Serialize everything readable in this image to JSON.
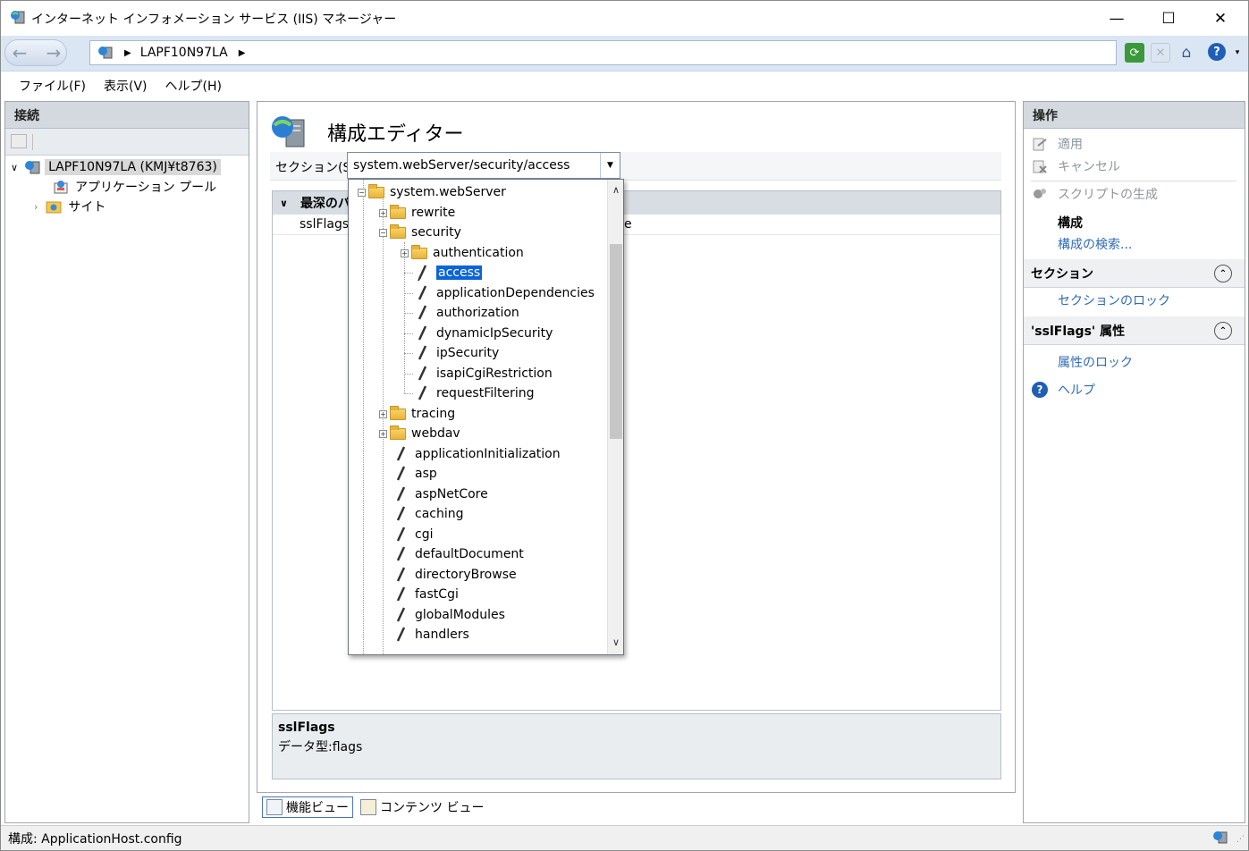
{
  "window": {
    "title": "インターネット インフォメーション サービス (IIS) マネージャー",
    "minimize": "—",
    "maximize": "☐",
    "close": "✕"
  },
  "address": {
    "back_icon": "back-arrow-icon",
    "forward_icon": "forward-arrow-icon",
    "path": "LAPF10N97LA",
    "sep": "▶"
  },
  "toolbar_icons": [
    "refresh-icon",
    "stop-icon",
    "home-icon",
    "help-icon"
  ],
  "menu": [
    "ファイル(F)",
    "表示(V)",
    "ヘルプ(H)"
  ],
  "connections": {
    "title": "接続",
    "tree": {
      "server": "LAPF10N97LA (KMJ¥t8763)",
      "app_pools": "アプリケーション プール",
      "sites": "サイト"
    }
  },
  "center": {
    "title": "構成エディター",
    "section_label": "セクション(S):",
    "section_value": "system.webServer/security/access",
    "grid_header": "最深のパ",
    "grid_row": "sslFlags",
    "grid_row_tail": "e",
    "desc_title": "sslFlags",
    "desc_type": "データ型:flags"
  },
  "dropdown": {
    "root": "system.webServer",
    "items": {
      "rewrite": "rewrite",
      "security": "security",
      "authentication": "authentication",
      "access": "access",
      "applicationDependencies": "applicationDependencies",
      "authorization": "authorization",
      "dynamicIpSecurity": "dynamicIpSecurity",
      "ipSecurity": "ipSecurity",
      "isapiCgiRestriction": "isapiCgiRestriction",
      "requestFiltering": "requestFiltering",
      "tracing": "tracing",
      "webdav": "webdav",
      "applicationInitialization": "applicationInitialization",
      "asp": "asp",
      "aspNetCore": "aspNetCore",
      "caching": "caching",
      "cgi": "cgi",
      "defaultDocument": "defaultDocument",
      "directoryBrowse": "directoryBrowse",
      "fastCgi": "fastCgi",
      "globalModules": "globalModules",
      "handlers": "handlers"
    }
  },
  "views": {
    "features": "機能ビュー",
    "content": "コンテンツ ビュー"
  },
  "actions": {
    "title": "操作",
    "apply": "適用",
    "cancel": "キャンセル",
    "generate_script": "スクリプトの生成",
    "config_heading": "構成",
    "search_config": "構成の検索...",
    "section_heading": "セクション",
    "lock_section": "セクションのロック",
    "attr_heading": "'sslFlags' 属性",
    "lock_attr": "属性のロック",
    "help": "ヘルプ"
  },
  "status": {
    "text": "構成: ApplicationHost.config"
  },
  "colors": {
    "accent": "#0a64d8",
    "link": "#2f6bb5",
    "header_bg": "#d4d9df"
  }
}
